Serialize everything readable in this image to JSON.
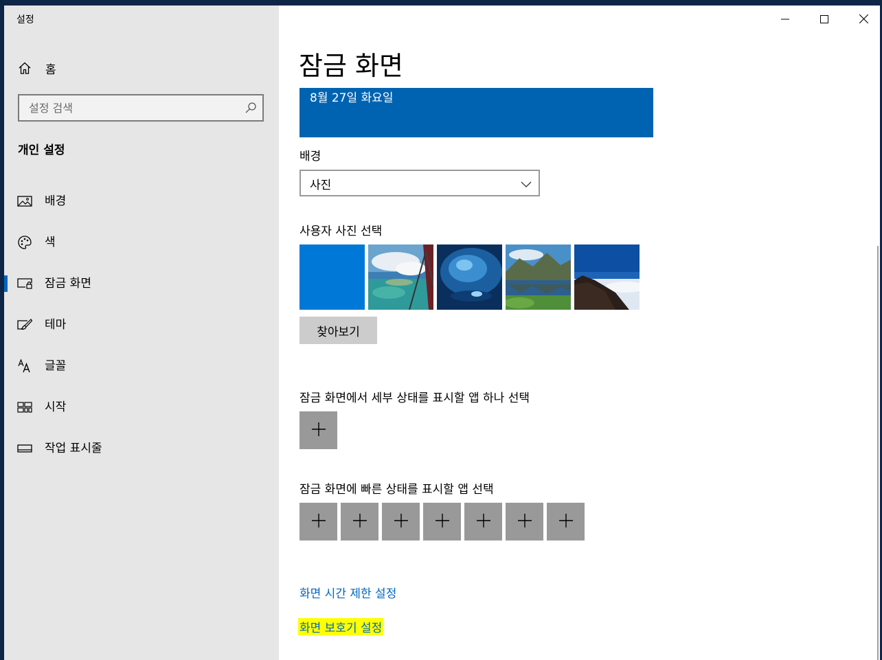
{
  "window": {
    "title": "설정",
    "controls": {
      "minimize_icon": "minimize-icon",
      "maximize_icon": "maximize-icon",
      "close_icon": "close-icon"
    }
  },
  "sidebar": {
    "home_label": "홈",
    "search_placeholder": "설정 검색",
    "section_title": "개인 설정",
    "items": [
      {
        "label": "배경",
        "icon": "picture-icon",
        "active": false
      },
      {
        "label": "색",
        "icon": "palette-icon",
        "active": false
      },
      {
        "label": "잠금 화면",
        "icon": "lock-screen-icon",
        "active": true
      },
      {
        "label": "테마",
        "icon": "theme-brush-icon",
        "active": false
      },
      {
        "label": "글꼴",
        "icon": "font-icon",
        "active": false
      },
      {
        "label": "시작",
        "icon": "start-tiles-icon",
        "active": false
      },
      {
        "label": "작업 표시줄",
        "icon": "taskbar-icon",
        "active": false
      }
    ]
  },
  "main": {
    "title": "잠금 화면",
    "preview_date": "8월 27일 화요일",
    "background_label": "배경",
    "background_value": "사진",
    "choose_photo_label": "사용자 사진 선택",
    "browse_button": "찾아보기",
    "detailed_status_label": "잠금 화면에서 세부 상태를 표시할 앱 하나 선택",
    "quick_status_label": "잠금 화면에 빠른 상태를 표시할 앱 선택",
    "screen_timeout_link": "화면 시간 제한 설정",
    "screen_saver_link": "화면 보호기 설정"
  },
  "colors": {
    "accent": "#0067c0",
    "preview_bg": "#0063b1",
    "highlight": "#ffff00",
    "sidebar_bg": "#e6e6e6"
  }
}
